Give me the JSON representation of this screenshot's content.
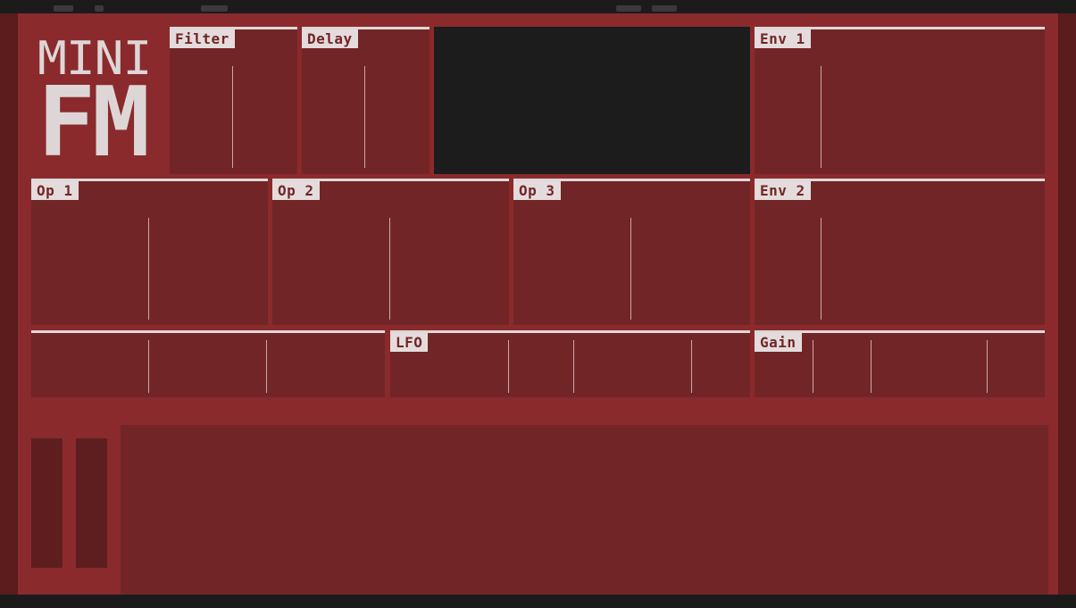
{
  "app": {
    "logo_line1": "MINI",
    "logo_line2": "FM"
  },
  "panels": {
    "filter": "Filter",
    "delay": "Delay",
    "env1": "Env 1",
    "op1": "Op 1",
    "op2": "Op 2",
    "op3": "Op 3",
    "env2": "Env 2",
    "lfo": "LFO",
    "gain": "Gain"
  },
  "colors": {
    "background": "#8a2a2c",
    "panel": "#722527",
    "label_bg": "#e4dcdc",
    "display": "#1c1c1c"
  }
}
